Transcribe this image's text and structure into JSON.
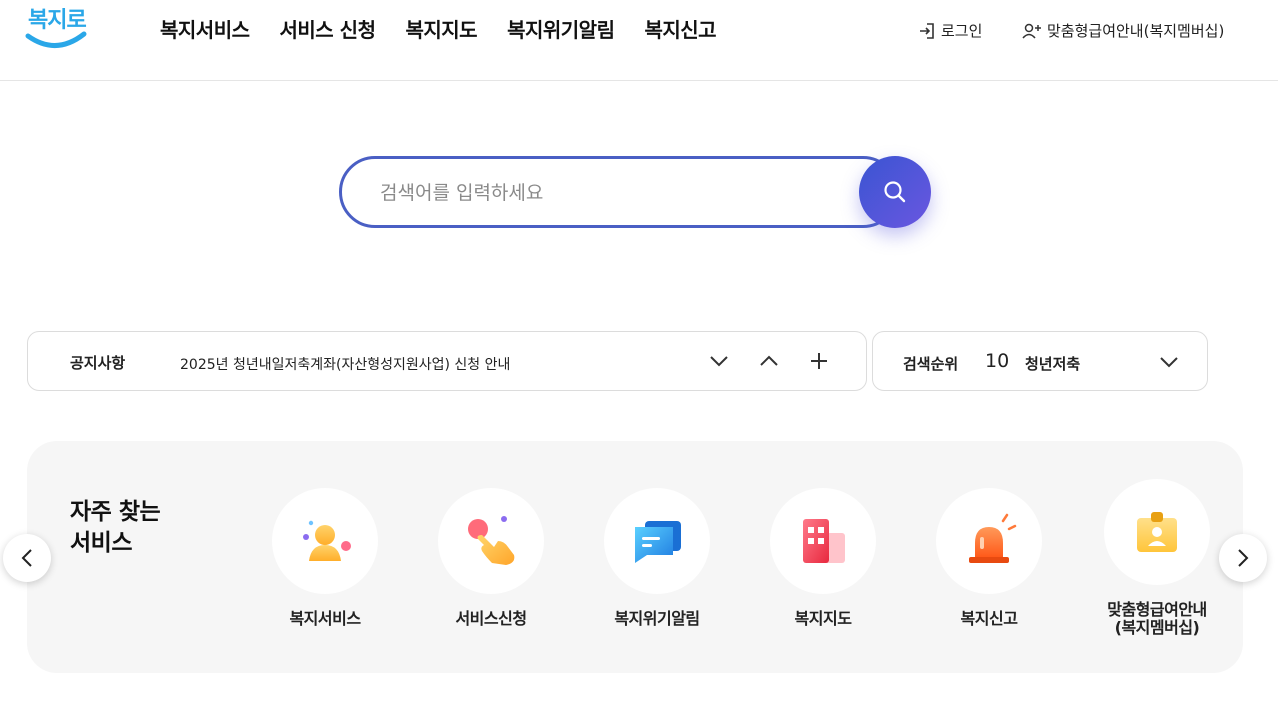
{
  "header": {
    "logo_text": "복지로",
    "nav": [
      "복지서비스",
      "서비스 신청",
      "복지지도",
      "복지위기알림",
      "복지신고"
    ],
    "login_label": "로그인",
    "member_label": "맞춤형급여안내(복지멤버십)"
  },
  "search": {
    "placeholder": "검색어를 입력하세요",
    "value": ""
  },
  "notice": {
    "label": "공지사항",
    "text": "2025년 청년내일저축계좌(자산형성지원사업) 신청 안내"
  },
  "rank": {
    "label": "검색순위",
    "number": "10",
    "keyword": "청년저축"
  },
  "favorites": {
    "title_line1": "자주 찾는",
    "title_line2": "서비스",
    "items": [
      {
        "label": "복지서비스",
        "icon": "person-icon"
      },
      {
        "label": "서비스신청",
        "icon": "hand-click-icon"
      },
      {
        "label": "복지위기알림",
        "icon": "message-icon"
      },
      {
        "label": "복지지도",
        "icon": "building-map-icon"
      },
      {
        "label": "복지신고",
        "icon": "siren-icon"
      },
      {
        "label_line1": "맞춤형급여안내",
        "label_line2": "(복지멤버십)",
        "icon": "id-card-icon"
      }
    ]
  },
  "colors": {
    "accent": "#4a5fc4",
    "search_button": "#5a56d8",
    "logo": "#2aa7e8"
  }
}
